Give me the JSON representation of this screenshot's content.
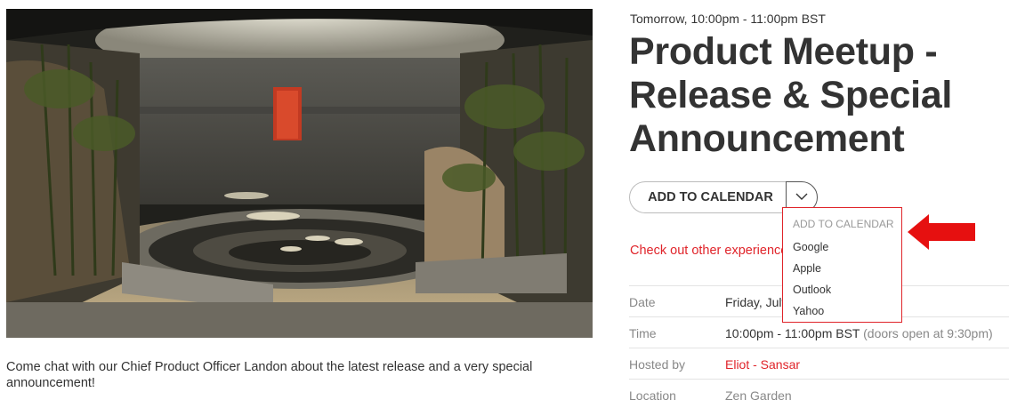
{
  "event": {
    "when": "Tomorrow, 10:00pm - 11:00pm BST",
    "title": "Product Meetup - Release & Special Announcement",
    "description": "Come chat with our Chief Product Officer Landon about the latest release and a very special announcement!"
  },
  "calendar": {
    "button_label": "ADD TO CALENDAR",
    "toggle_icon": "chevron-down-icon",
    "menu": {
      "header": "ADD TO CALENDAR",
      "items": [
        "Google",
        "Apple",
        "Outlook",
        "Yahoo"
      ]
    }
  },
  "other_link": "Check out other experiences",
  "details": {
    "date": {
      "label": "Date",
      "value": "Friday, July"
    },
    "time": {
      "label": "Time",
      "value": "10:00pm - 11:00pm BST",
      "note": "(doors open at 9:30pm)"
    },
    "host": {
      "label": "Hosted by",
      "value": "Eliot - Sansar"
    },
    "location": {
      "label": "Location",
      "value": "Zen Garden"
    }
  },
  "colors": {
    "accent": "#e0242a",
    "text": "#333333",
    "muted": "#888888"
  }
}
